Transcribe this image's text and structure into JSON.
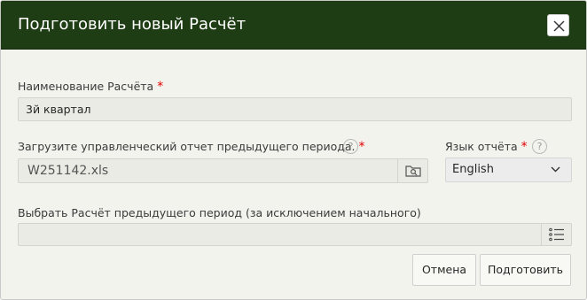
{
  "dialog": {
    "title": "Подготовить новый Расчёт",
    "close_icon": "close-icon"
  },
  "form": {
    "name_label": "Наименование Расчёта",
    "name_value": "3й квартал",
    "upload_label": "Загрузите управленческий отчет предыдущего периода.",
    "upload_value": "W251142.xls",
    "upload_icon": "folder-search-icon",
    "language_label": "Язык отчёта",
    "language_value": "English",
    "previous_label": "Выбрать Расчёт предыдущего период (за исключением начального)",
    "previous_value": "",
    "previous_icon": "list-icon",
    "required_mark": "*",
    "help_mark": "?"
  },
  "buttons": {
    "cancel": "Отмена",
    "submit": "Подготовить"
  },
  "colors": {
    "header": "#1f3d14",
    "body": "#f3f3ee",
    "required": "#e00000"
  }
}
